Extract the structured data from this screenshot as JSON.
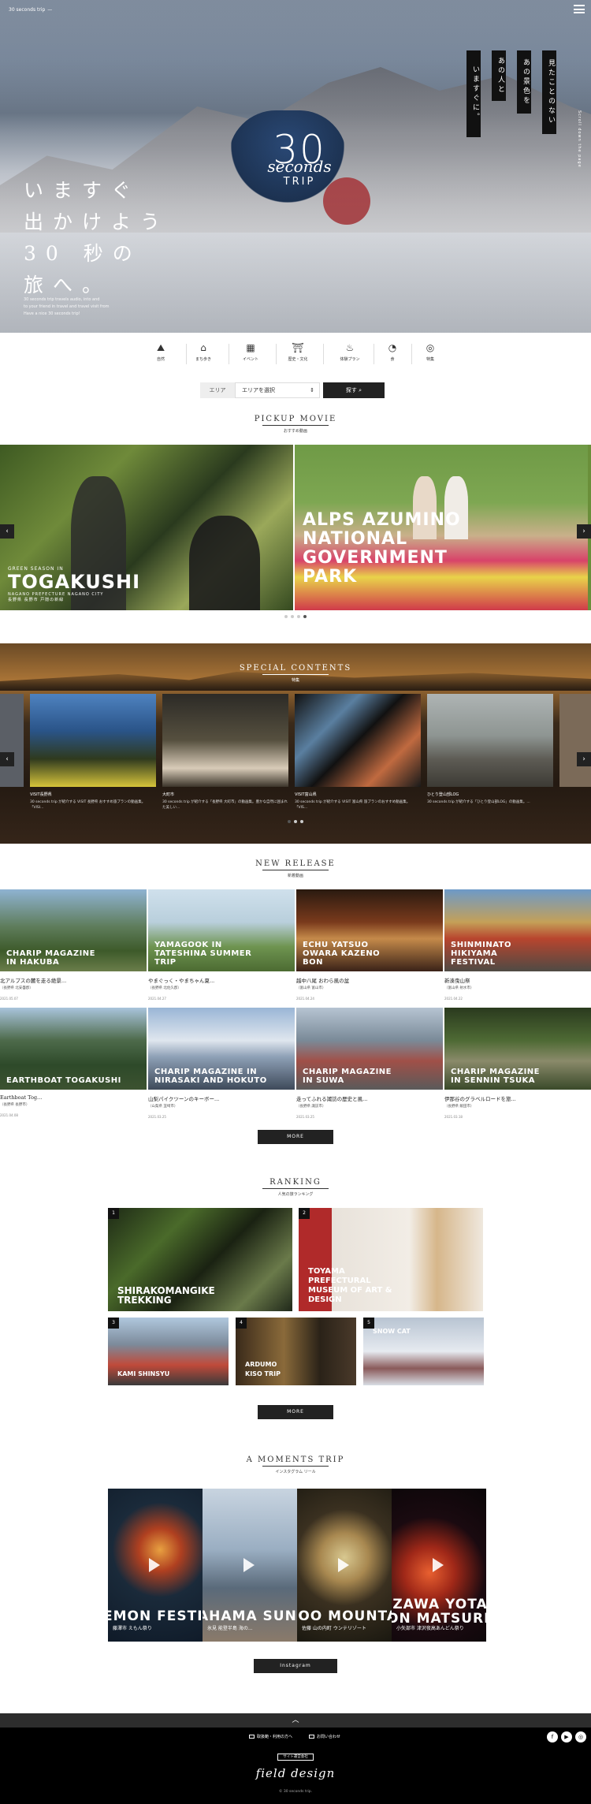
{
  "header": {
    "logo": "30 seconds trip",
    "logo_sub": "—",
    "hero_logo": {
      "number": "30",
      "script": "seconds",
      "word": "TRIP"
    },
    "catch_lines": [
      "いますぐ",
      "出かけよう",
      "30 秒の",
      "旅へ。"
    ],
    "catch_sub": [
      "30 seconds trip travels audio, into and",
      "to your friend in travel and travel visit from",
      "Have a nice 30 seconds trip!"
    ],
    "vertical_copy": [
      "見たことのない",
      "あの景色を",
      "あの人と",
      "いますぐに。"
    ],
    "vertical_side": "Scroll down the page"
  },
  "categories": [
    {
      "icon": "mountain-icon",
      "glyph": "⛰",
      "label": "自然"
    },
    {
      "icon": "town-icon",
      "glyph": "⌂",
      "label": "まち歩き"
    },
    {
      "icon": "calendar-icon",
      "glyph": "▦",
      "label": "イベント"
    },
    {
      "icon": "temple-icon",
      "glyph": "⛩",
      "label": "歴史・文化"
    },
    {
      "icon": "onsen-icon",
      "glyph": "♨",
      "label": "体験プラン"
    },
    {
      "icon": "food-icon",
      "glyph": "◔",
      "label": "食"
    },
    {
      "icon": "feature-icon",
      "glyph": "◎",
      "label": "特集"
    }
  ],
  "search": {
    "area_label": "エリア",
    "select_value": "エリアを選択",
    "button": "探す"
  },
  "pickup": {
    "title": "PICKUP MOVIE",
    "subtitle": "おすすめ動画",
    "slides": [
      {
        "small": "GREEN SEASON IN",
        "big": "TOGAKUSHI",
        "sub": "NAGANO PREFECTURE NAGANO CITY",
        "jp": "長野県 長野市 戸隠の新緑"
      },
      {
        "small": "",
        "big": "ALPS AZUMINO NATIONAL GOVERNMENT PARK",
        "sub": "",
        "jp": ""
      }
    ],
    "prev": "‹",
    "next": "›"
  },
  "special": {
    "title": "SPECIAL CONTENTS",
    "subtitle": "特集",
    "cards": [
      {
        "label": "VISIT長野県",
        "text": "30 seconds trip が紹介する VISIT 長野県 おすすめ旅プランの動画集。「VISI..."
      },
      {
        "label": "大町市",
        "text": "30 seconds trip が紹介する「長野県 大町市」の動画集。豊かな自然に囲まれた美しい..."
      },
      {
        "label": "VISIT富山県",
        "text": "30 seconds trip が紹介する VISIT 富山県 旅プランのおすすめ動画集。「VIS..."
      },
      {
        "label": "ひとり登山部LOG",
        "text": "30 seconds trip が紹介する「ひとり登山部LOG」の動画集。..."
      }
    ]
  },
  "new_release": {
    "title": "NEW RELEASE",
    "subtitle": "新着動画",
    "items": [
      {
        "overlay": "CHARIP MAGAZINE IN HAKUBA",
        "title": "北アルプスの麓を走る絶景...",
        "place": "（長野県 北安曇郡）",
        "date": "2021.05.07"
      },
      {
        "overlay": "YAMAGOOK IN TATESHINA SUMMER TRIP",
        "title": "やまぐっく・やまちゃん夏...",
        "place": "（長野県 北佐久郡）",
        "date": "2021.04.27"
      },
      {
        "overlay": "ECHU YATSUO OWARA KAZENO BON",
        "title": "越中八尾 おわら風の盆",
        "place": "（富山県 富山市）",
        "date": "2021.04.24"
      },
      {
        "overlay": "SHINMINATO HIKIYAMA FESTIVAL",
        "title": "新湊曳山祭",
        "place": "（富山県 射水市）",
        "date": "2021.04.22"
      },
      {
        "overlay": "EARTHBOAT TOGAKUSHI",
        "title": "Earthboat Tog...",
        "place": "（長野県 長野市）",
        "date": "2021.04.08"
      },
      {
        "overlay": "CHARIP MAGAZINE IN NIRASAKI AND HOKUTO",
        "title": "山梨パイクツーンのキーボー...",
        "place": "（山梨県 韮崎市）",
        "date": "2021.03.25"
      },
      {
        "overlay": "CHARIP MAGAZINE IN SUWA",
        "title": "走ってふれる諏訪の歴史と風...",
        "place": "（長野県 諏訪市）",
        "date": "2021.03.25"
      },
      {
        "overlay": "CHARIP MAGAZINE IN SENNIN TSUKA",
        "title": "伊那谷のグラベルロードを旅...",
        "place": "（長野県 飯田市）",
        "date": "2021.03.18"
      }
    ],
    "more": "MORE"
  },
  "ranking": {
    "title": "RANKING",
    "subtitle": "人気の旅ランキング",
    "items": [
      {
        "rank": "1",
        "caption": "SHIRAKOMANGIKE TREKKING"
      },
      {
        "rank": "2",
        "caption": "TOYAMA PREFECTURAL MUSEUM OF ART & DESIGN"
      },
      {
        "rank": "3",
        "caption": "KAMI SHINSYU"
      },
      {
        "rank": "4",
        "caption": "ARDUMO KISO TRIP"
      },
      {
        "rank": "5",
        "caption": "SNOW CAT"
      }
    ],
    "more": "MORE"
  },
  "moments": {
    "title": "A MOMENTS TRIP",
    "subtitle": "インスタグラム リール",
    "items": [
      {
        "caption": "EMON FESTIV",
        "sub": "藤澤市 えもん祭り"
      },
      {
        "caption": "AHAMA SUNSORT",
        "sub": "氷見 能登半島 海の..."
      },
      {
        "caption": "JOO MOUNTAI",
        "sub": "佐藤 山の内町 ウンテリゾート"
      },
      {
        "caption": "IZAWA YOTAK ON MATSURI",
        "sub": "小矢部市 津沢夜高あんどん祭り"
      }
    ],
    "button": "Instagram"
  },
  "footer": {
    "top": "︿",
    "links": [
      "取扱範・利用の方へ",
      "お問い合わせ"
    ],
    "badge": "サイト運営会社",
    "company": "field design",
    "copyright": "© 30 seconds trip.",
    "sns": [
      "f",
      "▶",
      "◎"
    ]
  }
}
